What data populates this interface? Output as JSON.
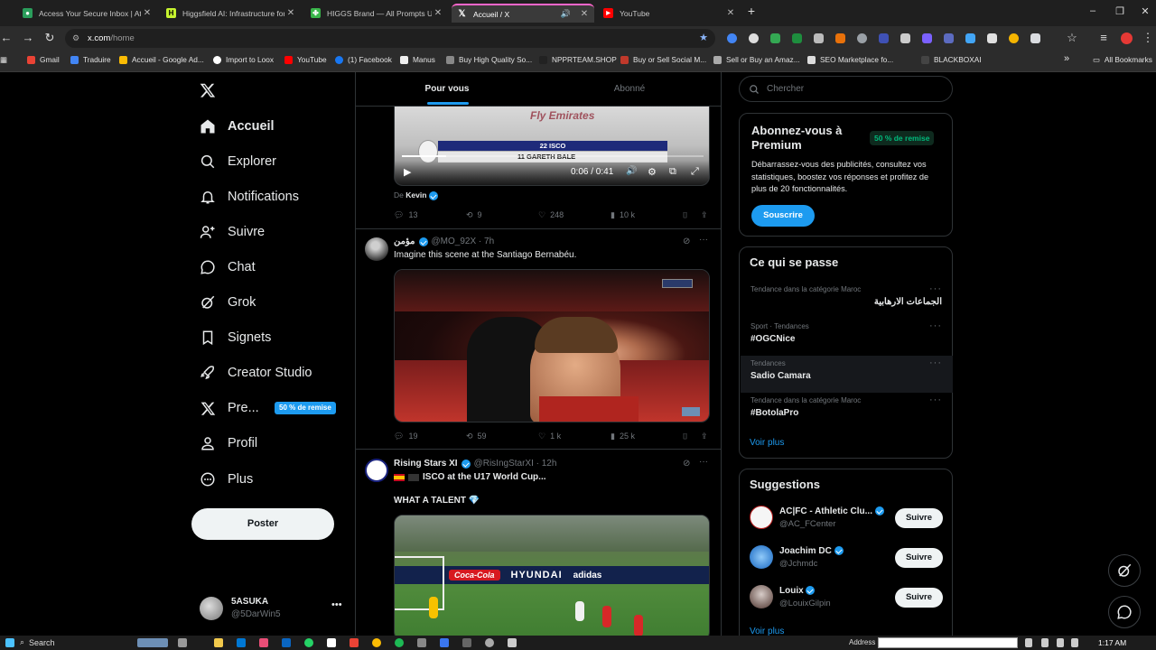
{
  "browser": {
    "tabs": [
      {
        "title": "Access Your Secure Inbox | Ato",
        "favicon": "mail-icon",
        "color": "#2a9d5b"
      },
      {
        "title": "Higgsfield AI: Infrastructure for",
        "favicon": "higgsfield-icon",
        "color": "#c6f32f"
      },
      {
        "title": "HIGGS Brand — All Prompts Us",
        "favicon": "clover-icon",
        "color": "#39b54a"
      },
      {
        "title": "Accueil / X",
        "favicon": "x-icon",
        "color": "#000000",
        "active": true
      },
      {
        "title": "YouTube",
        "favicon": "youtube-icon",
        "color": "#ff0000"
      }
    ],
    "url_host": "x.com",
    "url_path": "/home",
    "bookmarks": [
      {
        "label": "Gmail",
        "color": "#ea4335"
      },
      {
        "label": "Traduire",
        "color": "#4285f4"
      },
      {
        "label": "Accueil - Google Ad...",
        "color": "#fbbc04"
      },
      {
        "label": "Import to Loox",
        "color": "#ffffff"
      },
      {
        "label": "YouTube",
        "color": "#ff0000"
      },
      {
        "label": "(1) Facebook",
        "color": "#1877f2"
      },
      {
        "label": "Manus",
        "color": "#ffffff"
      },
      {
        "label": "Buy High Quality So...",
        "color": "#888888"
      },
      {
        "label": "NPPRTEAM.SHOP",
        "color": "#222222"
      },
      {
        "label": "Buy or Sell Social M...",
        "color": "#c0392b"
      },
      {
        "label": "Sell or Buy an Amaz...",
        "color": "#aaaaaa"
      },
      {
        "label": "SEO Marketplace fo...",
        "color": "#dddddd"
      },
      {
        "label": "BLACKBOXAI",
        "color": "#444444"
      }
    ],
    "all_bookmarks": "All Bookmarks"
  },
  "sidebar": {
    "items": [
      {
        "label": "Accueil",
        "icon": "home-icon",
        "active": true
      },
      {
        "label": "Explorer",
        "icon": "search-icon"
      },
      {
        "label": "Notifications",
        "icon": "bell-icon"
      },
      {
        "label": "Suivre",
        "icon": "person-plus-icon"
      },
      {
        "label": "Chat",
        "icon": "chat-icon"
      },
      {
        "label": "Grok",
        "icon": "grok-icon"
      },
      {
        "label": "Signets",
        "icon": "bookmark-icon"
      },
      {
        "label": "Creator Studio",
        "icon": "rocket-icon"
      },
      {
        "label": "Pre...",
        "icon": "x-premium-icon",
        "badge": "50 % de remise"
      },
      {
        "label": "Profil",
        "icon": "profile-icon"
      },
      {
        "label": "Plus",
        "icon": "more-circle-icon"
      }
    ],
    "post_button": "Poster",
    "account": {
      "name": "5ASUKA",
      "handle": "@5DarWin5"
    }
  },
  "feed": {
    "tabs": [
      "Pour vous",
      "Abonné"
    ],
    "tweet1": {
      "video_time": "0:06 / 0:41",
      "scoreboard_top": "22 ISCO",
      "scoreboard_bottom": "11  GARETH BALE",
      "shirt_text": "Fly Emirates",
      "from_prefix": "De",
      "from_name": "Kevin",
      "replies": "13",
      "reposts": "9",
      "likes": "248",
      "views": "10 k"
    },
    "tweet2": {
      "name": "مؤمن",
      "handle": "@MO_92X · 7h",
      "text": "Imagine this scene at the Santiago Bernabéu.",
      "replies": "19",
      "reposts": "59",
      "likes": "1 k",
      "views": "25 k"
    },
    "tweet3": {
      "name": "Rising Stars XI",
      "handle": "@RisIngStarXI · 12h",
      "line1": "ISCO at the U17 World Cup...",
      "line2": "WHAT A TALENT 💎",
      "ad1": "Coca-Cola",
      "ad2": "HYUNDAI",
      "ad3": "adidas"
    }
  },
  "right": {
    "search_placeholder": "Chercher",
    "premium": {
      "title": "Abonnez-vous à Premium",
      "badge": "50 % de remise",
      "body": "Débarrassez-vous des publicités, consultez vos statistiques, boostez vos réponses et profitez de plus de 20 fonctionnalités.",
      "button": "Souscrire"
    },
    "trends_title": "Ce qui se passe",
    "trends": [
      {
        "category": "Tendance dans la catégorie Maroc",
        "name": "الجماعات الارهابية",
        "rtl": true
      },
      {
        "category": "Sport · Tendances",
        "name": "#OGCNice"
      },
      {
        "category": "Tendances",
        "name": "Sadio Camara"
      },
      {
        "category": "Tendance dans la catégorie Maroc",
        "name": "#BotolaPro"
      }
    ],
    "trends_more": "Voir plus",
    "suggestions_title": "Suggestions",
    "suggestions": [
      {
        "name": "AC|FC - Athletic Clu...",
        "handle": "@AC_FCenter",
        "button": "Suivre"
      },
      {
        "name": "Joachim DC",
        "handle": "@Jchmdc",
        "button": "Suivre"
      },
      {
        "name": "Louix",
        "handle": "@LouixGilpin",
        "button": "Suivre"
      }
    ],
    "suggestions_more": "Voir plus"
  },
  "taskbar": {
    "search": "Search",
    "address": "Address",
    "time": "1:17 AM"
  },
  "colors": {
    "accent": "#1d9bf0",
    "premium_badge_bg": "#0e2a1e",
    "premium_badge_fg": "#00ba7c"
  }
}
